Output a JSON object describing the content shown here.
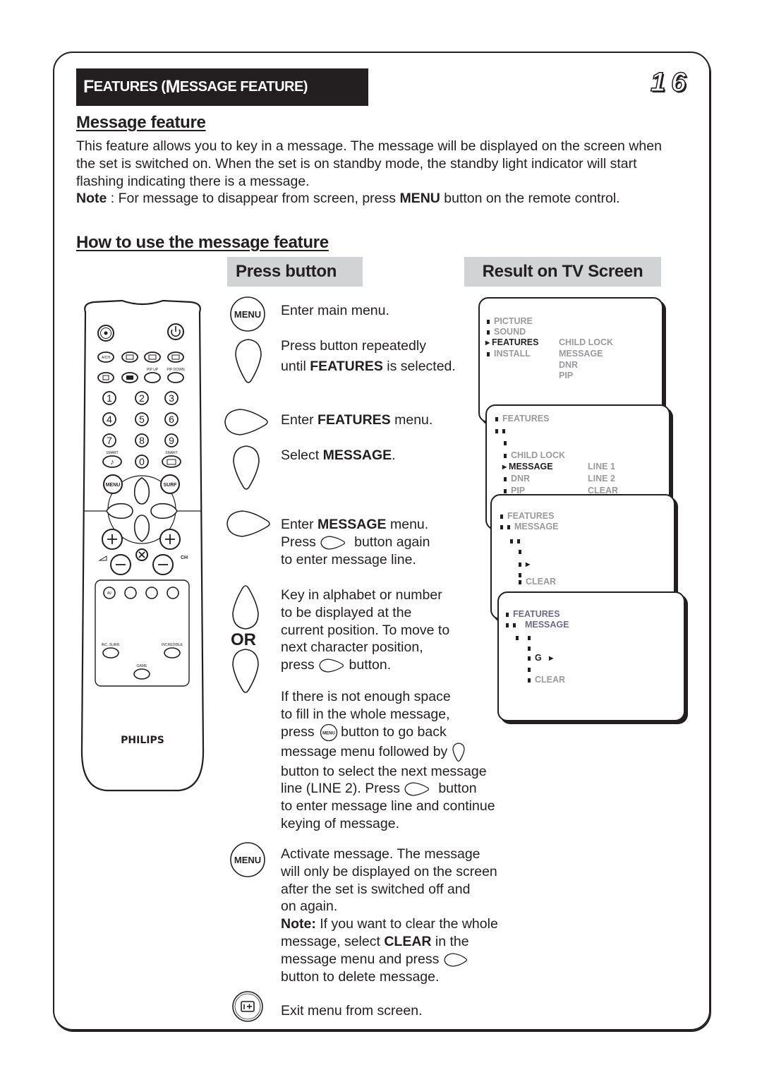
{
  "header": {
    "title_cap1": "F",
    "title_rest1": "EATURES (",
    "title_cap2": "M",
    "title_rest2": "ESSAGE FEATURE)",
    "page_number": "16"
  },
  "intro": {
    "heading": "Message feature",
    "body": "This feature allows you to key in a message. The message will be displayed on the screen when the set is switched on. When the set is on standby mode,  the standby light indicator will start flashing indicating there is a message.",
    "note_label": "Note",
    "note_text_1": " : For message to disappear from screen, press ",
    "note_bold": "MENU",
    "note_text_2": " button on the remote control."
  },
  "howto": {
    "heading": "How to use the message feature",
    "col_press": "Press button",
    "col_result": "Result on TV Screen"
  },
  "steps": {
    "s1": "Enter main menu.",
    "s2a": "Press button repeatedly",
    "s2b_1": "until ",
    "s2b_bold": "FEATURES",
    "s2b_2": " is selected.",
    "s3_1": "Enter ",
    "s3_bold": "FEATURES",
    "s3_2": " menu.",
    "s4_1": "Select ",
    "s4_bold": "MESSAGE",
    "s4_2": ".",
    "s5a_1": "Enter ",
    "s5a_bold": "MESSAGE",
    "s5a_2": " menu.",
    "s5b_1": "Press ",
    "s5b_2": "button again",
    "s5c": "to enter message line.",
    "s6a": "Key in alphabet or number",
    "s6b": "to be displayed at the",
    "s6c": "current position. To move to",
    "s6d": "next character position,",
    "s6e_1": "press ",
    "s6e_2": "button.",
    "or_label": "OR",
    "s7a": "If there is not enough space",
    "s7b": "to fill in the whole message,",
    "s7c_1": "press ",
    "s7c_2": "button to go back",
    "s7d": "message menu followed by",
    "s7e": "button to select the next message",
    "s7f_1": "line (LINE 2). Press ",
    "s7f_2": "button",
    "s7g": "to enter message line and continue",
    "s7h": "keying of message.",
    "s8a": "Activate message. The message",
    "s8b": "will only be displayed on the screen",
    "s8c": "after the set is switched off and",
    "s8d": "on again.",
    "s8e_bold": "Note:",
    "s8e": " If you want to clear the whole",
    "s8f_1": "message, select ",
    "s8f_bold": "CLEAR",
    "s8f_2": " in the",
    "s8g": "message menu and  press",
    "s8h": "button to delete message.",
    "s9": "Exit menu from screen.",
    "menu_label": "MENU"
  },
  "tv_screens": {
    "screen1": {
      "items": [
        "PICTURE",
        "SOUND",
        "FEATURES",
        "INSTALL"
      ],
      "selected": "FEATURES",
      "submenu": [
        "CHILD LOCK",
        "MESSAGE",
        "DNR",
        "PIP"
      ]
    },
    "screen2": {
      "title": "FEATURES",
      "items": [
        "CHILD LOCK",
        "MESSAGE",
        "DNR",
        "PIP"
      ],
      "selected": "MESSAGE",
      "submenu": [
        "LINE 1",
        "LINE 2",
        "CLEAR"
      ]
    },
    "screen3": {
      "title": "FEATURES",
      "subtitle": "MESSAGE",
      "clear": "CLEAR"
    },
    "screen4": {
      "title": "FEATURES",
      "subtitle": "MESSAGE",
      "entered_char": "G",
      "clear": "CLEAR"
    }
  },
  "remote": {
    "brand": "PHILIPS",
    "labels": {
      "ach": "A/CH",
      "pip_up": "PIP UP",
      "pip_down": "PIP DOWN",
      "smart1": "SMART",
      "smart2": "SMART",
      "menu": "MENU",
      "surf": "SURF",
      "ch": "CH",
      "av": "AV",
      "inc_surr": "INC. SURR.",
      "incredible": "INCREDIBLE",
      "game": "GAME"
    },
    "digits": [
      "1",
      "2",
      "3",
      "4",
      "5",
      "6",
      "7",
      "8",
      "9",
      "0"
    ]
  }
}
